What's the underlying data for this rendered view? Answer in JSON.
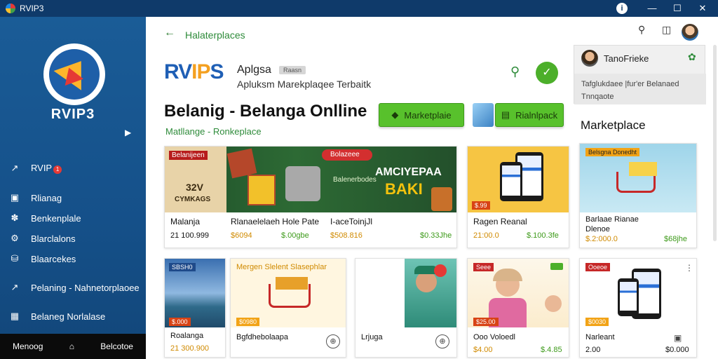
{
  "window": {
    "title": "RVIP3",
    "center_icon": "i"
  },
  "sidebar": {
    "brand": "RVIP3",
    "items": [
      {
        "label": "RVIP",
        "icon": "share-icon",
        "badge": "1"
      },
      {
        "label": "Rlianag",
        "icon": "image-icon"
      },
      {
        "label": "Benkenplale",
        "icon": "image-icon"
      },
      {
        "label": "Blarclalons",
        "icon": "gear-icon"
      },
      {
        "label": "Blaarcekes",
        "icon": "chat-icon"
      },
      {
        "label": "Pelaning - Nahnetorplaoee",
        "icon": "share-icon"
      },
      {
        "label": "Belaneg Norlalase",
        "icon": "grid-icon"
      }
    ],
    "footer": {
      "left": "Menoog",
      "right": "Belcotoe"
    }
  },
  "header": {
    "back_icon": "arrow-left-icon",
    "breadcrumb": "Halaterplaces"
  },
  "app": {
    "logo_r": "RV",
    "logo_v": "IP",
    "logo_s": "S",
    "name": "Aplgsa",
    "tag": "Raasn",
    "subtitle": "Apluksm Marekplaqee Terbaitk"
  },
  "page": {
    "title": "Belanig - Belanga Onlline",
    "subtitle": "Matllange - Ronkeplace",
    "btn_marketplace": "Marketplaie",
    "btn_marketpack": "Rialnlpack"
  },
  "right_panel": {
    "user": "TanoFrieke",
    "text": "Tafglukdaee |fur'er Belanaed Tnnqaote",
    "section_title": "Marketplace"
  },
  "cards": [
    {
      "banner_left": "Belanijeen",
      "banner_left_num": "32V",
      "banner_left_sub": "CYMKAGS",
      "banner_right_tag": "Bolazeee",
      "banner_big": "AMCIYEPAA",
      "banner_big2": "BAKI",
      "banner_mid": "Balenerbodes",
      "col1_title": "Malanja",
      "col1_price": "21 100.999",
      "col2_title": "Rlanaelelaeh Hole Pate",
      "col2_price": "$6094",
      "col2_price2": "$.00gbe",
      "col3_title": "I-aceToinjJl",
      "col3_price": "$508.816",
      "col3_price2": "$0.33Jhe"
    },
    {
      "badge": "$.99",
      "title": "Ragen Reanal",
      "price": "21:00.0",
      "price2": "$.100.3fe"
    },
    {
      "banner": "Belsgna Donedht",
      "title": "Barlaae Rianae",
      "title2": "Dlenoe",
      "price": "$.2:000.0",
      "price2": "$68jhe"
    },
    {
      "badge": "SBSH0",
      "badge2": "$.000",
      "title": "Roalanga",
      "price": "21 300.900"
    },
    {
      "header": "Mergen Slelent Slasephlar",
      "badge": "$0980",
      "title": "Bgfdhebolaapa"
    },
    {
      "title": "Lrjuga"
    },
    {
      "badge": "Seee",
      "badge2": "$25.00",
      "title": "Ooo Voloedl",
      "price": "$4.00",
      "price2": "$.4.85"
    },
    {
      "badge": "Ooeoe",
      "badge2": "$0030",
      "title": "Narleant",
      "price": "2.00",
      "price2": "$0.000"
    }
  ]
}
